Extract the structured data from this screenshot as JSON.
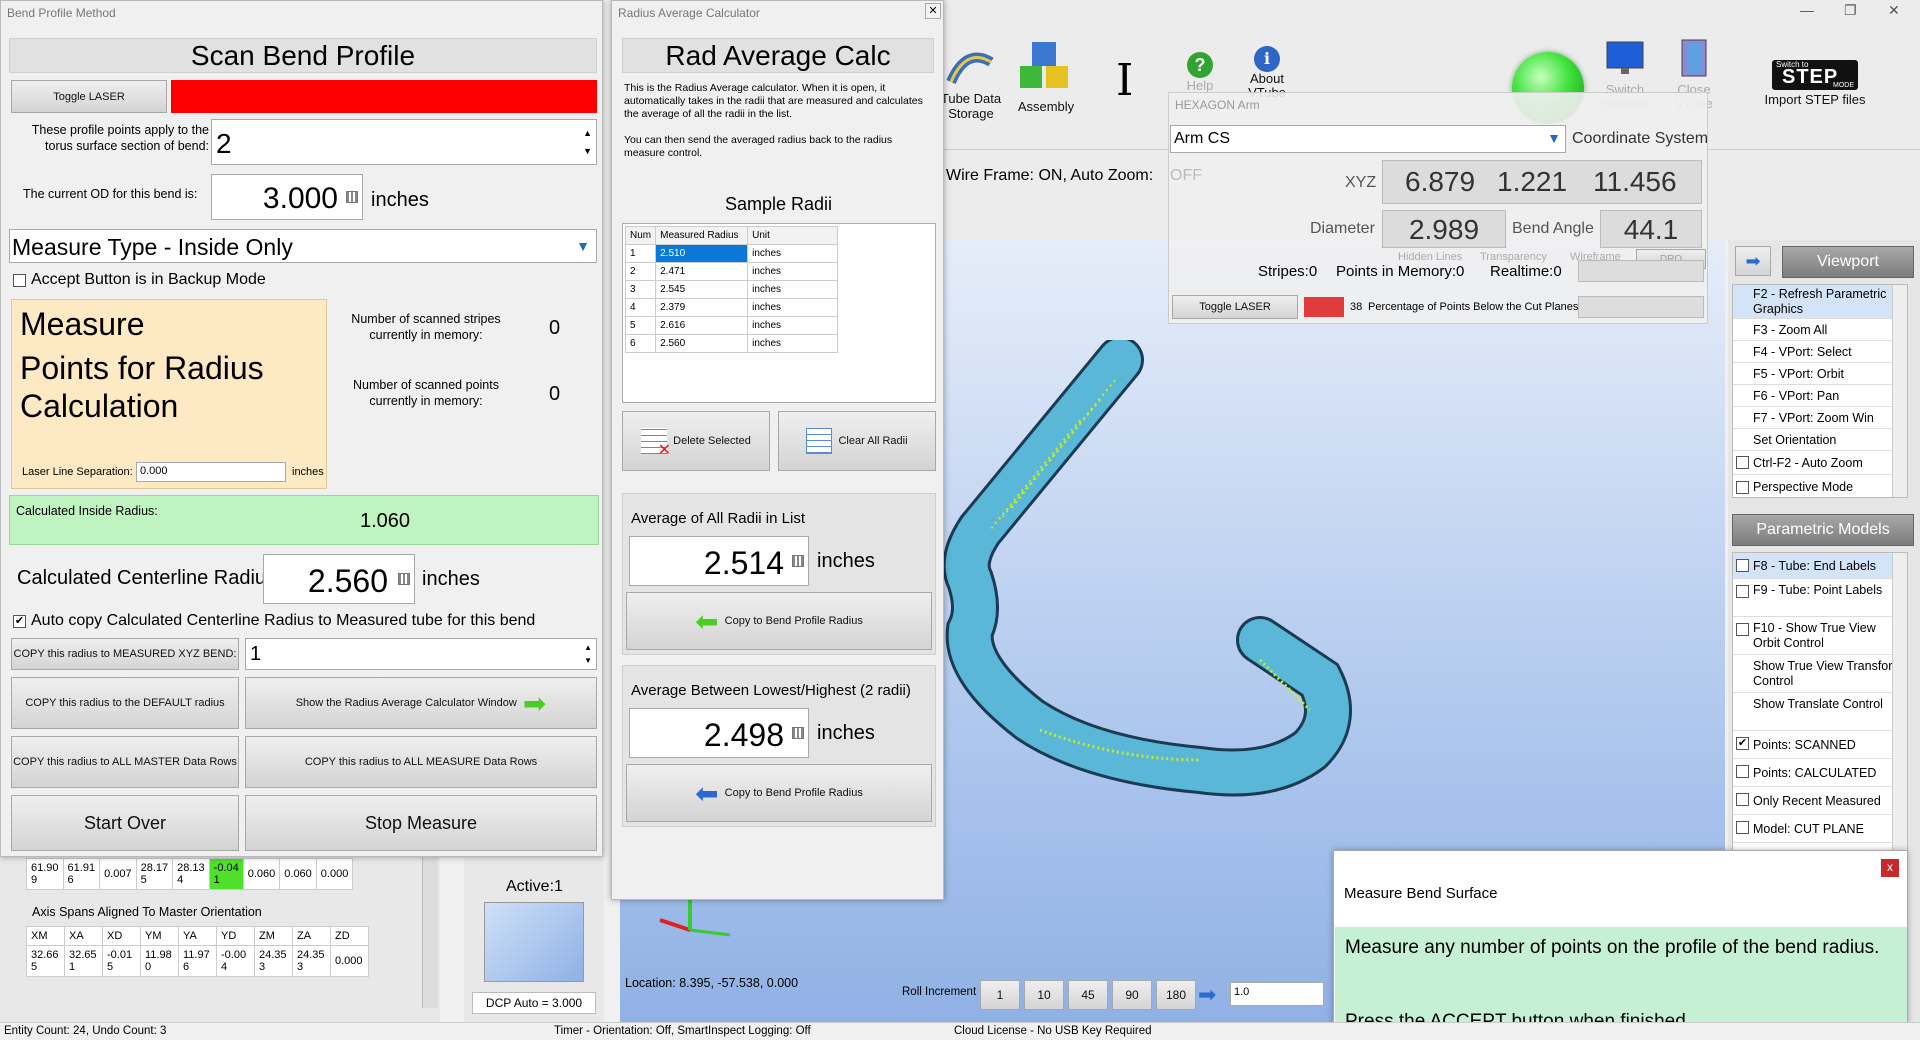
{
  "ribbon": {
    "tube_data_storage": "Tube Data Storage",
    "assembly": "Assembly",
    "help": "Help",
    "about_vtube": "About VTube",
    "switch_screens": "Switch Screens",
    "close_vtube": "Close VTube",
    "import_step_small": "Switch to",
    "import_step_logo": "STEP",
    "import_step_mode": "MODE",
    "import_step": "Import STEP files"
  },
  "hexagon": {
    "title": "HEXAGON Arm",
    "cs_value": "Arm CS",
    "coord_system": "Coordinate System",
    "xyz_label": "XYZ",
    "x": "6.879",
    "y": "1.221",
    "z": "11.456",
    "diameter_label": "Diameter",
    "diameter": "2.989",
    "bend_angle_label": "Bend Angle",
    "bend_angle": "44.1",
    "stripes": "Stripes:0",
    "points_in_memory": "Points in Memory:0",
    "realtime": "Realtime:0",
    "toggle_laser": "Toggle LASER",
    "pct_value": "38",
    "pct_label": "Percentage of Points Below the Cut Planes",
    "hidden_lines": "Hidden Lines",
    "transparency": "Transparency",
    "wireframe": "Wireframe",
    "dro": "DRO"
  },
  "viewport_status": {
    "wire_frame": "Wire Frame: ON, Auto Zoom:",
    "auto_zoom": "OFF"
  },
  "bend_profile": {
    "window_title": "Bend Profile Method",
    "header": "Scan Bend Profile",
    "toggle_laser": "Toggle LASER",
    "profile_points_label": "These profile points apply to the torus surface section of bend:",
    "profile_points_value": "2",
    "od_label": "The current OD for this bend is:",
    "od_value": "3.000",
    "od_unit": "inches",
    "measure_type": "Measure Type - Inside Only",
    "accept_backup": "Accept Button is in Backup Mode",
    "instruction_1": "Measure",
    "instruction_2": "Points for Radius",
    "instruction_3": "Calculation",
    "laser_sep_label": "Laser Line Separation:",
    "laser_sep_value": "0.000",
    "laser_sep_unit": "inches",
    "stripes_label": "Number of scanned stripes currently in memory:",
    "stripes_value": "0",
    "points_label": "Number of scanned points currently in memory:",
    "points_value": "0",
    "calc_inside_label": "Calculated Inside Radius:",
    "calc_inside_value": "1.060",
    "calc_center_label": "Calculated Centerline Radius",
    "calc_center_value": "2.560",
    "calc_center_unit": "inches",
    "auto_copy": "Auto copy Calculated Centerline Radius to Measured tube for this bend",
    "copy_xyz": "COPY this radius to MEASURED XYZ BEND:",
    "copy_xyz_value": "1",
    "copy_default": "COPY this radius to the DEFAULT radius",
    "show_calc": "Show the Radius Average Calculator Window",
    "copy_master": "COPY this radius to ALL MASTER Data Rows",
    "copy_measure": "COPY this radius to ALL MEASURE Data Rows",
    "start_over": "Start Over",
    "stop_measure": "Stop Measure"
  },
  "radius_calc": {
    "window_title": "Radius Average Calculator",
    "header": "Rad Average Calc",
    "desc_1": "This is the Radius Average calculator. When it is open, it automatically takes in the radii that are measured and calculates the average of all the radii in the list.",
    "desc_2": "You can then send the averaged radius back to the radius measure control.",
    "sample_title": "Sample Radii",
    "columns": [
      "Num",
      "Measured Radius",
      "Unit"
    ],
    "rows": [
      [
        "1",
        "2.510",
        "inches"
      ],
      [
        "2",
        "2.471",
        "inches"
      ],
      [
        "3",
        "2.545",
        "inches"
      ],
      [
        "4",
        "2.379",
        "inches"
      ],
      [
        "5",
        "2.616",
        "inches"
      ],
      [
        "6",
        "2.560",
        "inches"
      ]
    ],
    "delete_selected": "Delete Selected",
    "clear_all": "Clear All Radii",
    "avg_all_label": "Average of All Radii in List",
    "avg_all_value": "2.514",
    "avg_unit": "inches",
    "copy_to_profile": "Copy to Bend Profile Radius",
    "avg_between_label": "Average Between Lowest/Highest (2 radii)",
    "avg_between_value": "2.498"
  },
  "lower_left": {
    "row1": [
      "61.90\n9",
      "61.91\n6",
      "0.007",
      "28.17\n5",
      "28.13\n4",
      "-0.04\n1",
      "0.060",
      "0.060",
      "0.000"
    ],
    "spans_title": "Axis Spans Aligned To Master Orientation",
    "span_headers": [
      "XM",
      "XA",
      "XD",
      "YM",
      "YA",
      "YD",
      "ZM",
      "ZA",
      "ZD"
    ],
    "span_values": [
      "32.66\n5",
      "32.65\n1",
      "-0.01\n5",
      "11.98\n0",
      "11.97\n6",
      "-0.00\n4",
      "24.35\n3",
      "24.35\n3",
      "0.000"
    ],
    "active": "Active:1",
    "dcp_auto": "DCP Auto = 3.000"
  },
  "viewport": {
    "location": "Location: 8.395, -57.538, 0.000",
    "roll_increment": "Roll Increment",
    "rolls": [
      "1",
      "10",
      "45",
      "90",
      "180"
    ],
    "roll_value": "1.0"
  },
  "right_panel": {
    "viewport": "Viewport",
    "viewport_items": [
      "F2 - Refresh Parametric Graphics",
      "F3 - Zoom All",
      "F4 - VPort: Select",
      "F5 - VPort: Orbit",
      "F6 - VPort: Pan",
      "F7 - VPort: Zoom Win",
      "Set Orientation",
      "Ctrl-F2 - Auto Zoom",
      "Perspective Mode"
    ],
    "parametric_models": "Parametric Models",
    "model_items": [
      "F8 - Tube: End Labels",
      "F9 - Tube: Point Labels",
      "F10 - Show True View Orbit Control",
      "Show True View Transform Control",
      "Show Translate Control",
      "Points: SCANNED",
      "Points: CALCULATED",
      "Only Recent Measured",
      "Model: CUT PLANE"
    ]
  },
  "measure_popup": {
    "title": "Measure Bend Surface",
    "close": "x",
    "line1": "Measure any number of points on the profile of the bend radius.",
    "line2": "Press the ACCEPT button when finished."
  },
  "status_bar": {
    "entity": "Entity Count: 24, Undo Count: 3",
    "timer": "Timer - Orientation: Off, SmartInspect Logging: Off",
    "license": "Cloud License - No USB Key Required"
  }
}
